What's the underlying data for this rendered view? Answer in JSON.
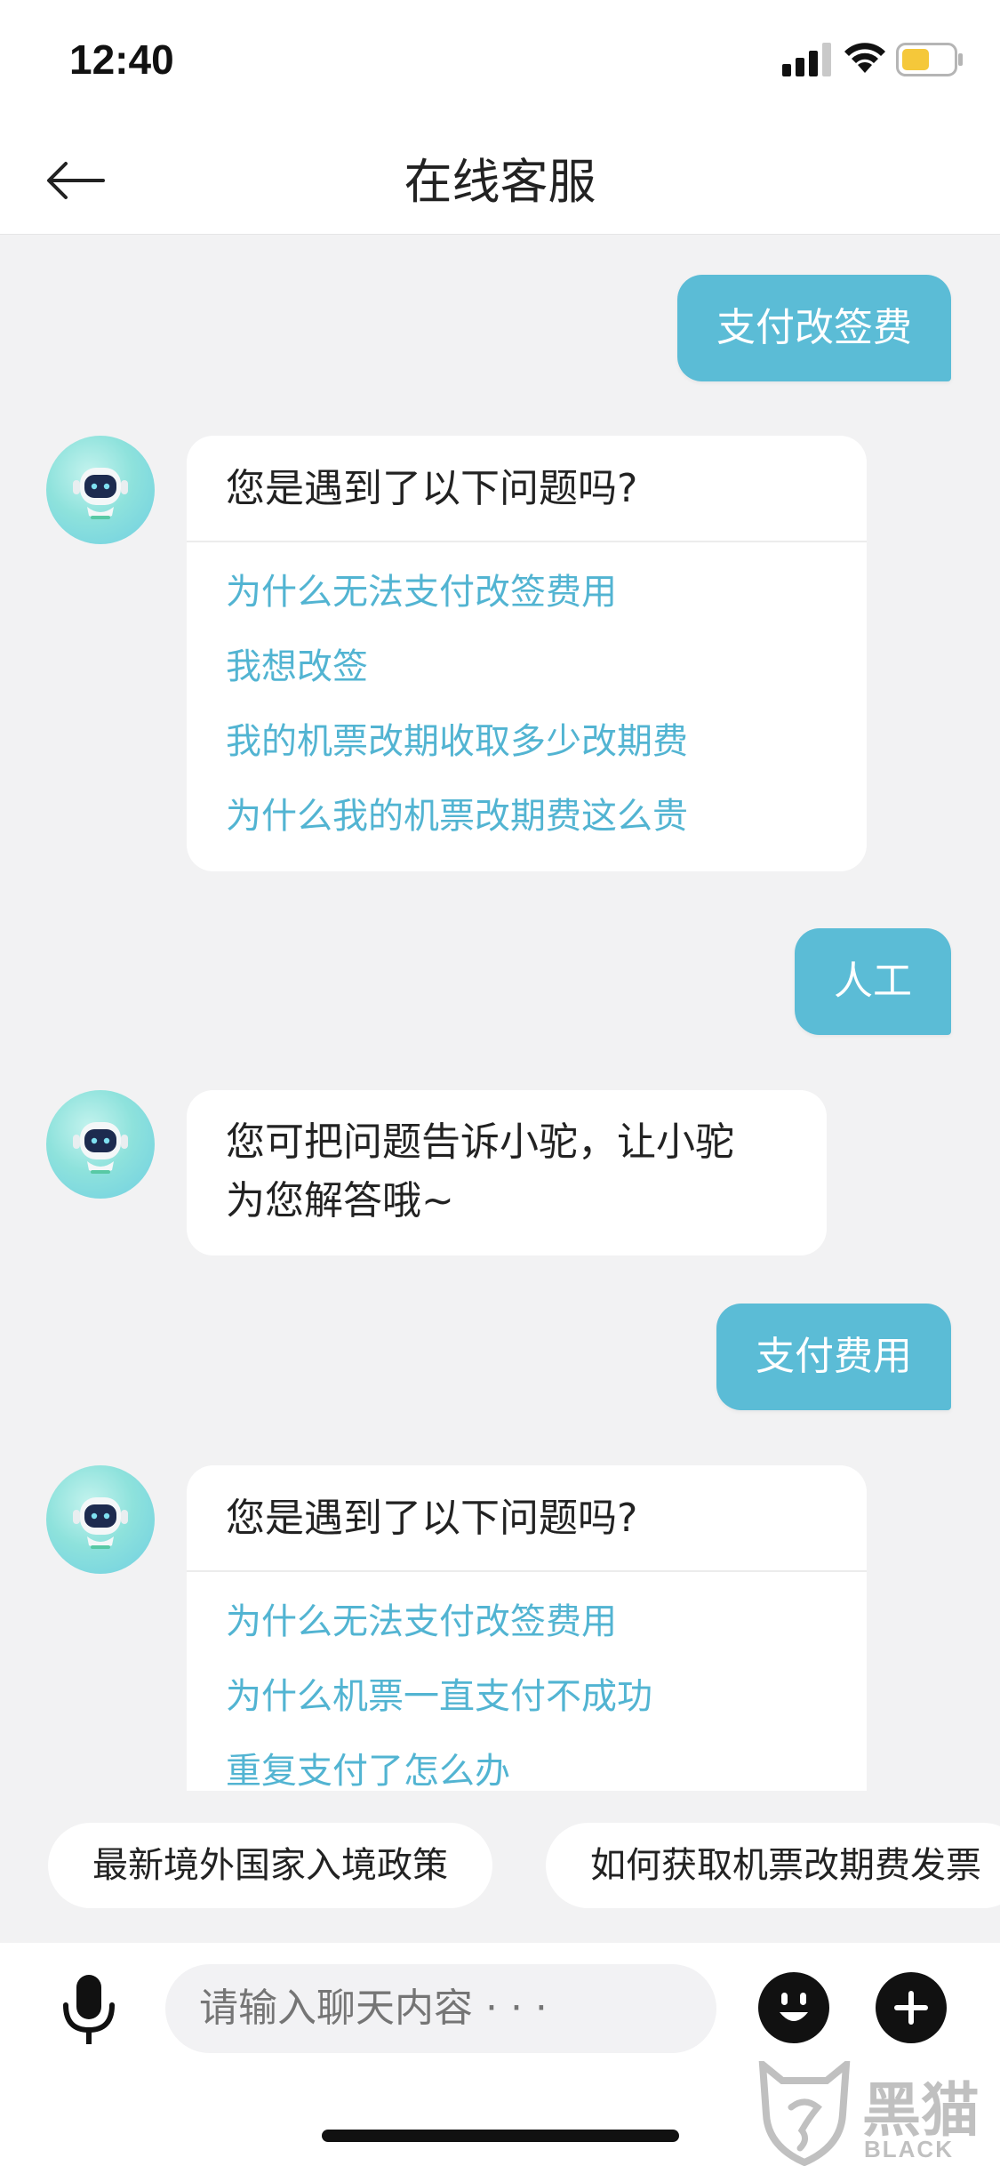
{
  "status_bar": {
    "time": "12:40",
    "signal_icon": "signal-icon",
    "wifi_icon": "wifi-icon",
    "battery_icon": "battery-icon",
    "battery_color": "#f5c83a"
  },
  "nav": {
    "back_icon": "back-arrow-icon",
    "title": "在线客服"
  },
  "theme": {
    "accent": "#5bbcd6",
    "link": "#52b4d2"
  },
  "messages": [
    {
      "from": "user",
      "text": "支付改签费"
    },
    {
      "from": "bot",
      "kind": "card",
      "head": "您是遇到了以下问题吗?",
      "links": [
        "为什么无法支付改签费用",
        "我想改签",
        "我的机票改期收取多少改期费",
        "为什么我的机票改期费这么贵"
      ]
    },
    {
      "from": "user",
      "text": "人工"
    },
    {
      "from": "bot",
      "kind": "text",
      "lines": [
        "您可把问题告诉小驼，让小驼",
        "为您解答哦~"
      ]
    },
    {
      "from": "user",
      "text": "支付费用"
    },
    {
      "from": "bot",
      "kind": "card",
      "head": "您是遇到了以下问题吗?",
      "links": [
        "为什么无法支付改签费用",
        "为什么机票一直支付不成功",
        "重复支付了怎么办"
      ]
    }
  ],
  "quick_replies": [
    "最新境外国家入境政策",
    "如何获取机票改期费发票"
  ],
  "input": {
    "placeholder": "请输入聊天内容 · · ·",
    "value": ""
  },
  "toolbar": {
    "mic_icon": "microphone-icon",
    "emoji_icon": "emoji-icon",
    "plus_icon": "plus-icon"
  },
  "watermark": {
    "brand": "黑猫",
    "sub": "BLACK CAT"
  }
}
